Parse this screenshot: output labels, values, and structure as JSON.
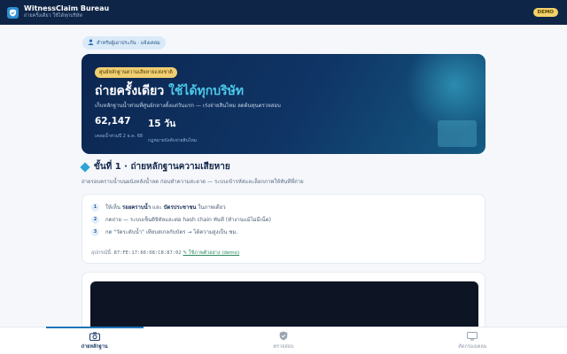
{
  "header": {
    "title": "WitnessClaim Bureau",
    "subtitle": "ถ่ายครั้งเดียว ใช้ได้ทุกบริษัท",
    "badge": "DEMO"
  },
  "audience_chip": "สำหรับผู้เอาประกัน · แจ้งเคลม",
  "hero": {
    "tag": "ศูนย์หลักฐานความเสียหายแห่งชาติ",
    "title_main": "ถ่ายครั้งเดียว ",
    "title_accent": "ใช้ได้ทุกบริษัท",
    "description": "เก็บหลักฐานน้ำท่วมที่ศูนย์กลางตั้งแต่วันแรก — เร่งจ่ายสินไหม ลดต้นทุนตรวจสอบ",
    "stats": [
      {
        "value": "62,147",
        "label": "เคลมน้ำท่วมปี 2 ธ.ค. 68"
      },
      {
        "value": "15 วัน",
        "label": "กฎหมายบังคับจ่ายสินไหม"
      }
    ]
  },
  "step": {
    "title": "ขั้นที่ 1 · ถ่ายหลักฐานความเสียหาย",
    "subtitle": "ถ่ายรอบคราบน้ำบนผนังหลังน้ำลด ก่อนทำความสะอาด — ระบบเข้ารหัสและล็อกภาพให้ทันทีที่ถ่าย"
  },
  "instructions": [
    {
      "num": "1",
      "pre": "ให้เห็น ",
      "b1": "รอยคราบน้ำ",
      "mid": " และ ",
      "b2": "บัตรประชาชน",
      "post": " ในภาพเดียว"
    },
    {
      "num": "2",
      "text": "กดถ่าย — ระบบเซ็นดิจิทัลและต่อ hash chain ทันที (ทำงานแม้ไม่มีเน็ต)"
    },
    {
      "num": "3",
      "text": "กด \"วัดระดับน้ำ\" เทียบสเกลกับบัตร → ได้ความสูงเป็น ซม."
    }
  ],
  "device": {
    "label": "อุปกรณ์นี้: ",
    "id": "87:FE:17:66:08:C8:87:02",
    "link": "✎ ใช้ภาพตัวอย่าง (demo)"
  },
  "bottom_nav": [
    {
      "label": "ถ่ายหลักฐาน",
      "icon": "camera-icon",
      "active": true
    },
    {
      "label": "ตรวจสอบ",
      "icon": "shield-icon",
      "active": false
    },
    {
      "label": "คัดกรองเคลม",
      "icon": "monitor-icon",
      "active": false
    }
  ],
  "colors": {
    "header_bg": "#0f2547",
    "hero_accent": "#4cc7e8",
    "badge": "#f2d16b",
    "active_tab": "#1d74b8"
  }
}
